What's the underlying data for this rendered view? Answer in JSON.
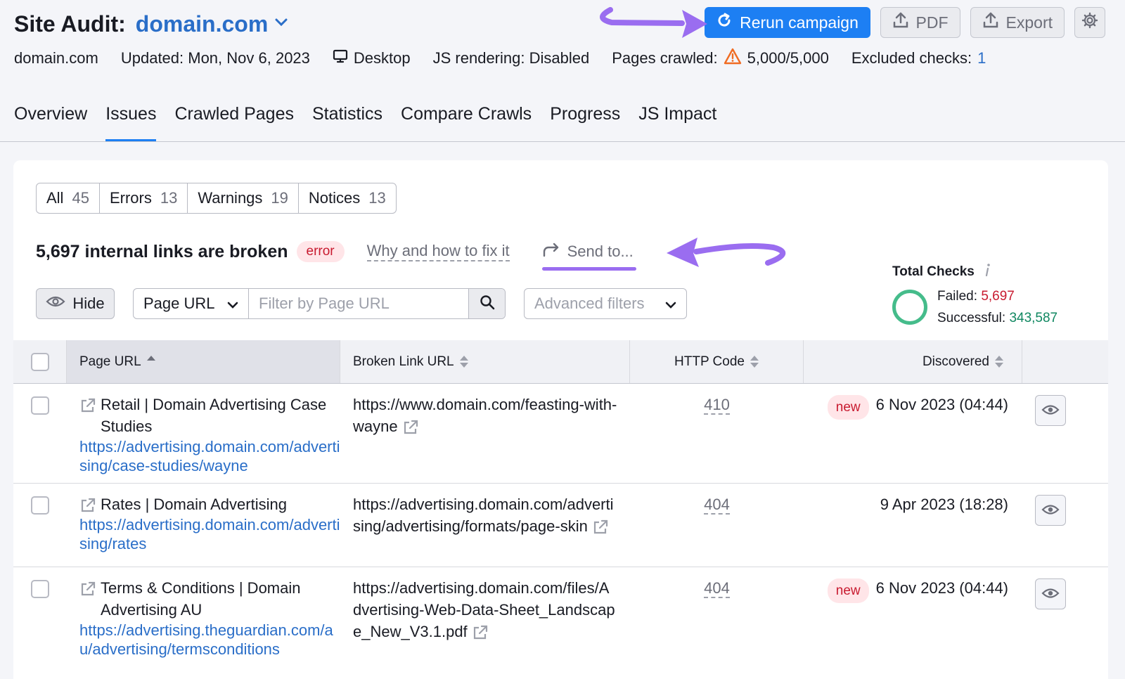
{
  "header": {
    "title_label": "Site Audit:",
    "project_domain": "domain.com",
    "actions": {
      "rerun": "Rerun campaign",
      "pdf": "PDF",
      "export": "Export"
    },
    "meta": {
      "domain": "domain.com",
      "updated": "Updated: Mon, Nov 6, 2023",
      "device": "Desktop",
      "js_rendering": "JS rendering: Disabled",
      "pages_crawled_label": "Pages crawled:",
      "pages_crawled_value": "5,000/5,000",
      "excluded_label": "Excluded checks:",
      "excluded_value": "1"
    }
  },
  "tabs": [
    {
      "label": "Overview",
      "active": false
    },
    {
      "label": "Issues",
      "active": true
    },
    {
      "label": "Crawled Pages",
      "active": false
    },
    {
      "label": "Statistics",
      "active": false
    },
    {
      "label": "Compare Crawls",
      "active": false
    },
    {
      "label": "Progress",
      "active": false
    },
    {
      "label": "JS Impact",
      "active": false
    }
  ],
  "filter_tabs": [
    {
      "label": "All",
      "count": "45"
    },
    {
      "label": "Errors",
      "count": "13"
    },
    {
      "label": "Warnings",
      "count": "19"
    },
    {
      "label": "Notices",
      "count": "13"
    }
  ],
  "issue": {
    "title": "5,697 internal links are broken",
    "badge": "error",
    "why_link": "Why and how to fix it",
    "send_to": "Send to..."
  },
  "totals": {
    "title": "Total Checks",
    "failed_label": "Failed:",
    "failed_value": "5,697",
    "successful_label": "Successful:",
    "successful_value": "343,587"
  },
  "controls": {
    "hide": "Hide",
    "select_value": "Page URL",
    "filter_placeholder": "Filter by Page URL",
    "advanced_filters": "Advanced filters"
  },
  "table": {
    "columns": {
      "page_url": "Page URL",
      "broken_link_url": "Broken Link URL",
      "http_code": "HTTP Code",
      "discovered": "Discovered"
    },
    "rows": [
      {
        "page_title": "Retail | Domain Advertising Case Studies",
        "page_url": "https://advertising.domain.com/advertising/case-studies/wayne",
        "broken_url": "https://www.domain.com/feasting-with-wayne",
        "http_code": "410",
        "badge": "new",
        "discovered": "6 Nov 2023 (04:44)"
      },
      {
        "page_title": "Rates | Domain Advertising",
        "page_url": "https://advertising.domain.com/advertising/rates",
        "broken_url": "https://advertising.domain.com/advertising/advertising/formats/page-skin",
        "http_code": "404",
        "badge": "",
        "discovered": "9 Apr 2023 (18:28)"
      },
      {
        "page_title": "Terms & Conditions | Domain Advertising AU",
        "page_url": "https://advertising.theguardian.com/au/advertising/termsconditions",
        "broken_url": "https://advertising.domain.com/files/Advertising-Web-Data-Sheet_Landscape_New_V3.1.pdf",
        "http_code": "404",
        "badge": "new",
        "discovered": "6 Nov 2023 (04:44)"
      }
    ]
  },
  "colors": {
    "primary": "#1d7ff3",
    "link": "#2a6ec8",
    "error": "#c81a2f",
    "success": "#0f8760",
    "annotation_arrow": "#9a6df0"
  }
}
